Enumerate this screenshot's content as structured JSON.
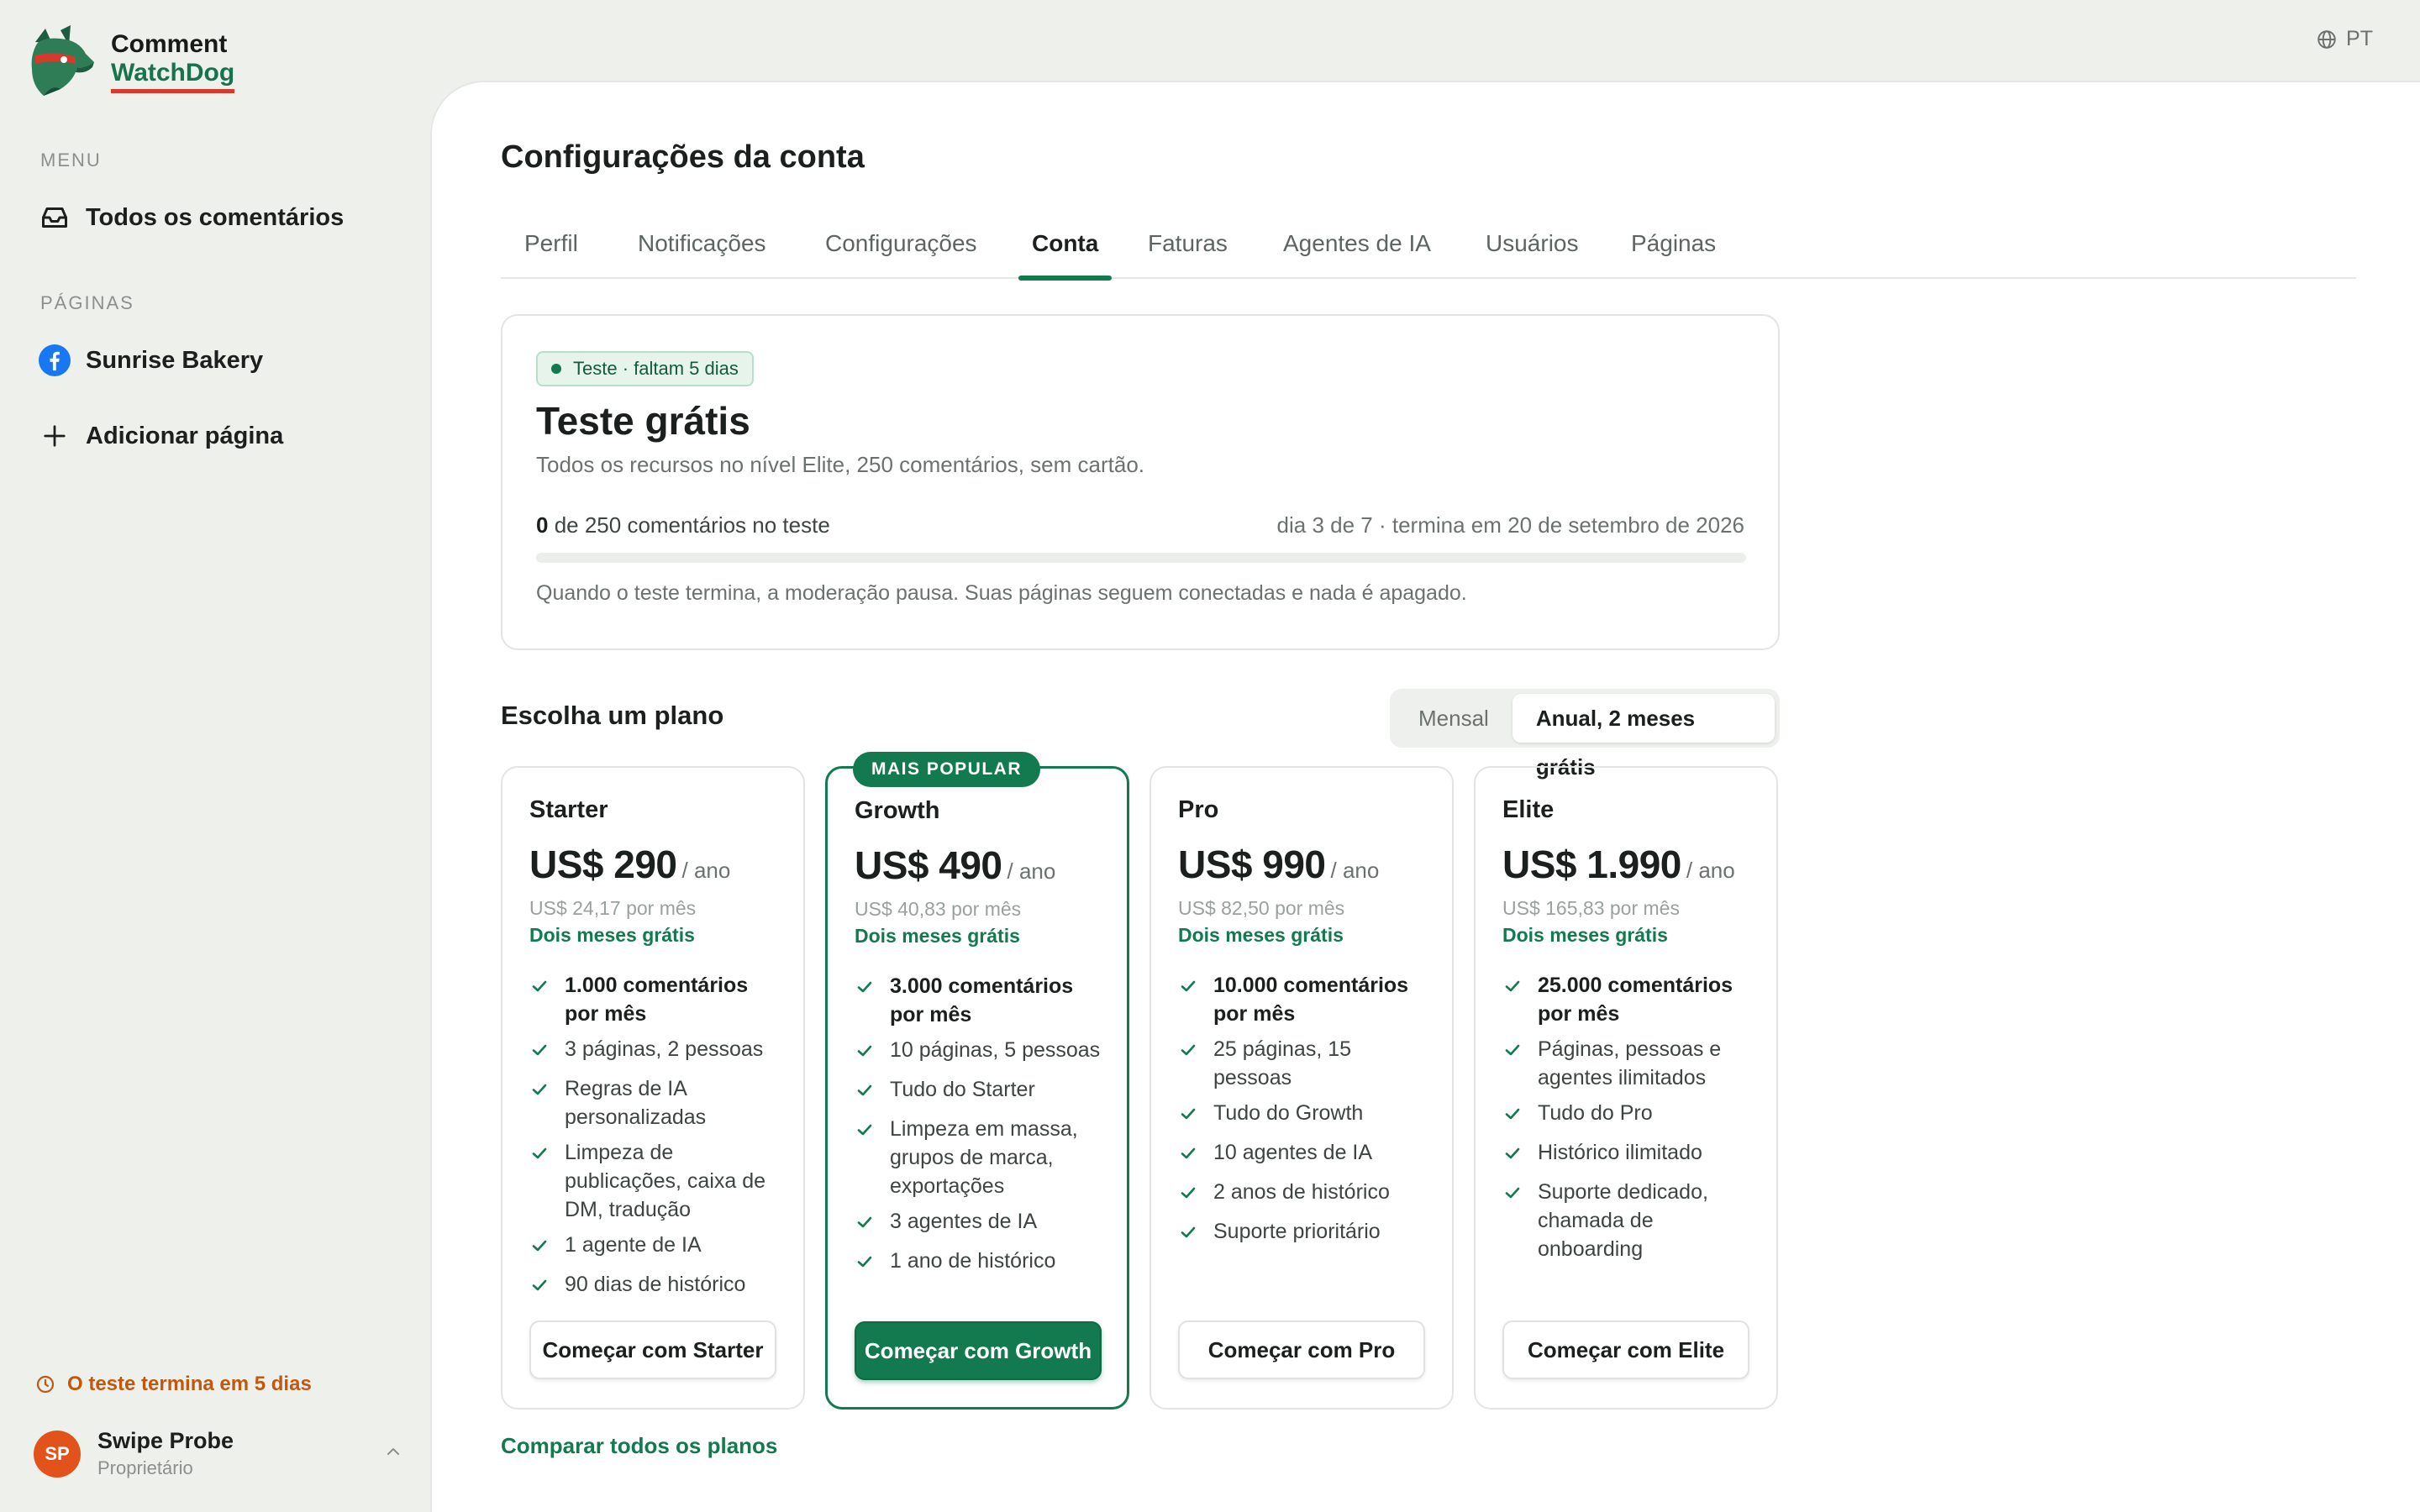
{
  "brand": {
    "line1": "Comment",
    "line2": "WatchDog"
  },
  "language": "PT",
  "sidebar": {
    "menu_label": "MENU",
    "menu_items": [
      {
        "label": "Todos os comentários",
        "icon": "inbox-icon"
      }
    ],
    "pages_label": "PÁGINAS",
    "pages": [
      {
        "label": "Sunrise Bakery",
        "icon": "facebook-icon"
      }
    ],
    "add_page": "Adicionar página",
    "trial_warning": "O teste termina em 5 dias",
    "user": {
      "initials": "SP",
      "name": "Swipe Probe",
      "role": "Proprietário"
    }
  },
  "page": {
    "title": "Configurações da conta",
    "tabs": [
      "Perfil",
      "Notificações",
      "Configurações",
      "Conta",
      "Faturas",
      "Agentes de IA",
      "Usuários",
      "Páginas"
    ],
    "active_tab": "Conta"
  },
  "trial": {
    "badge": "Teste · faltam 5 dias",
    "title": "Teste grátis",
    "subtitle": "Todos os recursos no nível Elite, 250 comentários, sem cartão.",
    "used": "0",
    "usage_text": " de 250 comentários no teste",
    "progress": 0,
    "period": "dia 3 de 7 · termina em 20 de setembro de 2026",
    "note": "Quando o teste termina, a moderação pausa. Suas páginas seguem conectadas e nada é apagado."
  },
  "plans_section": {
    "title": "Escolha um plano",
    "toggle": [
      "Mensal",
      "Anual, 2 meses grátis"
    ],
    "toggle_selected": "Anual, 2 meses grátis",
    "popular_tag": "MAIS POPULAR",
    "compare_link": "Comparar todos os planos",
    "plans": [
      {
        "name": "Starter",
        "price": "US$ 290",
        "period": "/ ano",
        "monthly": "US$ 24,17 por mês",
        "free": "Dois meses grátis",
        "features": [
          "1.000 comentários por mês",
          "3 páginas, 2 pessoas",
          "Regras de IA personalizadas",
          "Limpeza de publicações, caixa de DM, tradução",
          "1 agente de IA",
          "90 dias de histórico"
        ],
        "cta": "Começar com Starter"
      },
      {
        "name": "Growth",
        "price": "US$ 490",
        "period": "/ ano",
        "monthly": "US$ 40,83 por mês",
        "free": "Dois meses grátis",
        "features": [
          "3.000 comentários por mês",
          "10 páginas, 5 pessoas",
          "Tudo do Starter",
          "Limpeza em massa, grupos de marca, exportações",
          "3 agentes de IA",
          "1 ano de histórico"
        ],
        "cta": "Começar com Growth"
      },
      {
        "name": "Pro",
        "price": "US$ 990",
        "period": "/ ano",
        "monthly": "US$ 82,50 por mês",
        "free": "Dois meses grátis",
        "features": [
          "10.000 comentários por mês",
          "25 páginas, 15 pessoas",
          "Tudo do Growth",
          "10 agentes de IA",
          "2 anos de histórico",
          "Suporte prioritário"
        ],
        "cta": "Começar com Pro"
      },
      {
        "name": "Elite",
        "price": "US$ 1.990",
        "period": "/ ano",
        "monthly": "US$ 165,83 por mês",
        "free": "Dois meses grátis",
        "features": [
          "25.000 comentários por mês",
          "Páginas, pessoas e agentes ilimitados",
          "Tudo do Pro",
          "Histórico ilimitado",
          "Suporte dedicado, chamada de onboarding"
        ],
        "cta": "Começar com Elite"
      }
    ]
  },
  "colors": {
    "accent": "#137a4f",
    "warning": "#c2580f",
    "logo_underline": "#d63a2c"
  }
}
